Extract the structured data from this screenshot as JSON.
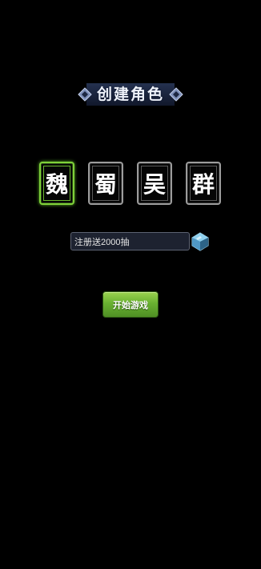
{
  "screen": {
    "title": "创建角色"
  },
  "factions": {
    "selected": "魏",
    "items": [
      {
        "label": "魏"
      },
      {
        "label": "蜀"
      },
      {
        "label": "吴"
      },
      {
        "label": "群"
      }
    ]
  },
  "name_field": {
    "value": "注册送2000抽"
  },
  "actions": {
    "start_label": "开始游戏"
  },
  "colors": {
    "background": "#000000",
    "selected_border": "#7fd13a",
    "card_border": "#9c9c9c",
    "button_green": "#69b131"
  },
  "icons": {
    "gem": "crystal-gem-icon",
    "title_ornament": "diamond-ornament-icon"
  }
}
